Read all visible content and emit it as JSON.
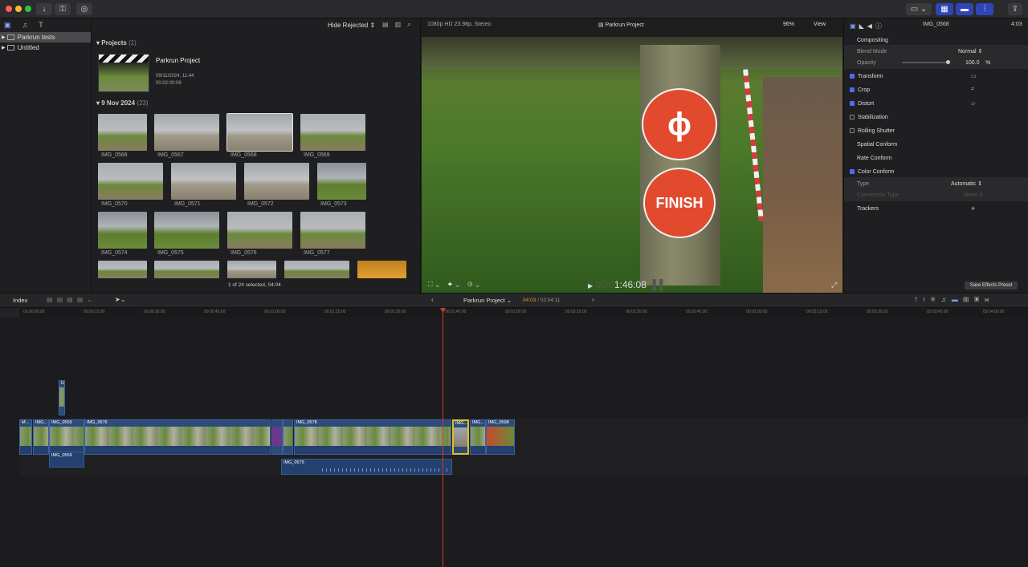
{
  "colors": {
    "accent": "#2e45b8",
    "playhead": "#d03a2a",
    "clip": "#2c4a7a",
    "selected_clip": "#e0c020",
    "timecode_highlight": "#e0a020"
  },
  "sidebar": {
    "items": [
      {
        "label": "Parkrun tests",
        "selected": true
      },
      {
        "label": "Untitled",
        "selected": false
      }
    ]
  },
  "browser": {
    "filter": "Hide Rejected ⇕",
    "projects_header": "Projects",
    "projects_count": "(1)",
    "project": {
      "name": "Parkrun Project",
      "date": "09/11/2024, 11:44",
      "duration": "00:02:00:08"
    },
    "event_header": "9 Nov 2024",
    "event_count": "(23)",
    "clips": [
      "IMG_0566",
      "IMG_0567",
      "IMG_0568",
      "IMG_0569",
      "IMG_0570",
      "IMG_0571",
      "IMG_0572",
      "IMG_0573",
      "IMG_0574",
      "IMG_0575",
      "IMG_0576",
      "IMG_0577"
    ],
    "status": "1 of 24 selected, 04:04"
  },
  "viewer": {
    "format": "1080p HD 23.98p, Stereo",
    "project_title": "Parkrun Project",
    "zoom": "96%",
    "view_label": "View",
    "timecode_dim": "00:0",
    "timecode": "1:46:08",
    "sign_text": "FINISH"
  },
  "inspector": {
    "clip_name": "IMG_0568",
    "duration": "4:03",
    "compositing": "Compositing",
    "blend_mode_label": "Blend Mode",
    "blend_mode_value": "Normal ⇕",
    "opacity_label": "Opacity",
    "opacity_value": "100.0",
    "opacity_unit": "%",
    "sections": [
      {
        "label": "Transform",
        "checked": true
      },
      {
        "label": "Crop",
        "checked": true
      },
      {
        "label": "Distort",
        "checked": true
      },
      {
        "label": "Stabilization",
        "checked": false
      },
      {
        "label": "Rolling Shutter",
        "checked": false
      },
      {
        "label": "Spatial Conform",
        "checked": null
      },
      {
        "label": "Rate Conform",
        "checked": null
      },
      {
        "label": "Color Conform",
        "checked": true
      }
    ],
    "type_label": "Type",
    "type_value": "Automatic ⇕",
    "conversion_label": "Conversion Type",
    "conversion_value": "None ⇕",
    "trackers_label": "Trackers",
    "trackers_add": "+",
    "save_preset": "Save Effects Preset"
  },
  "timeline": {
    "index_label": "Index",
    "project_name": "Parkrun Project ⌄",
    "position": "04:03",
    "total": "/ 02:04:11",
    "ruler": [
      "00:00:00:00",
      "00:00:15:00",
      "00:00:30:00",
      "00:00:45:00",
      "00:01:00:00",
      "00:01:15:00",
      "00:01:30:00",
      "00:01:45:00",
      "00:02:00:00",
      "00:02:15:00",
      "00:02:30:00",
      "00:02:45:00",
      "00:03:00:00",
      "00:03:15:00",
      "00:03:30:00",
      "00:03:45:00",
      "00:04:00:00"
    ],
    "connected_clip_label": "IL",
    "clip_labels": [
      "M...",
      "IMG...",
      "IMG_0559",
      "IMG_0576",
      "IMG_0578",
      "IMG...",
      "IMG...",
      "IMG_0598"
    ],
    "audio_labels": [
      "IMG_0559",
      "IMG_0579"
    ]
  }
}
